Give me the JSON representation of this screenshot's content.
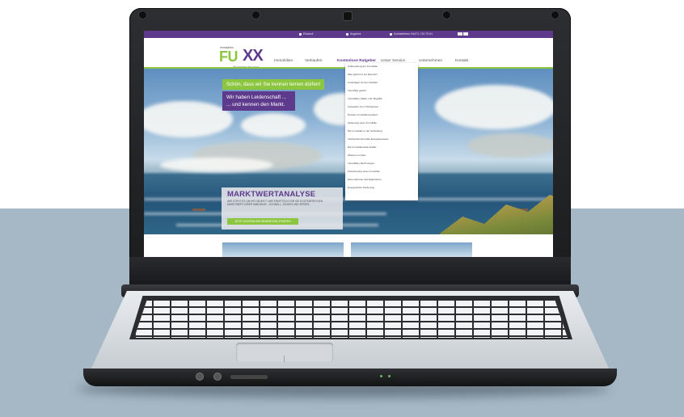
{
  "topbar": {
    "items": [
      "Rückruf",
      "Angebot",
      "Kontaktieren 04471 / 93 70 61"
    ]
  },
  "logo": {
    "top": "immobilien",
    "brand_fu": "FU",
    "brand_xx": "XX",
    "tagline": "Wir machen das schon"
  },
  "nav": {
    "items": [
      "Immobilien",
      "Verkaufen",
      "Kostenlose Ratgeber",
      "Unser Service",
      "Unternehmen",
      "Kontakt"
    ],
    "active_index": 2
  },
  "dropdown": {
    "items": [
      "Aufbereitung der Immobilie",
      "Was gehört in ein Exposé?",
      "Unterlagen für den Verkauf",
      "Immobilie geerbt",
      "Immobilien Fallen und -Begriffe",
      "Verkaufen zum Höchstpreis",
      "Privater Immobilienverkauf",
      "Sanierung einer Immobilie",
      "Die Immobilie in der Scheidung",
      "Verbraucherzentrale Energieausweis",
      "Die Immobilienwelt erklärt",
      "Wohnen im Alter",
      "Immobilien Rechnungen",
      "Finanzierung einer Immobilie",
      "Das Leibrente des Eigentümer",
      "Energetische Sanierung"
    ]
  },
  "hero": {
    "headline_green": "Schön, dass wir Sie kennen lernen dürfen!",
    "headline_purple": "Wir haben Leidenschaft ... ... und kennen den Markt."
  },
  "marktwert": {
    "title": "MARKTWERTANALYSE",
    "text": "WIE STEHT ES UM IHR OBJEKT? WIR ERMITTELN FÜR SIE KOSTENFREI DEN MARKTWERT IHRER IMMOBILIE – SCHNELL, SICHER UND SERIÖS.",
    "button": "JETZT KOSTENLOSE BEWERTUNG STARTEN"
  },
  "colors": {
    "brand_purple": "#5d3a8c",
    "brand_green": "#8cc63f",
    "backdrop": "#a6b8c6"
  }
}
